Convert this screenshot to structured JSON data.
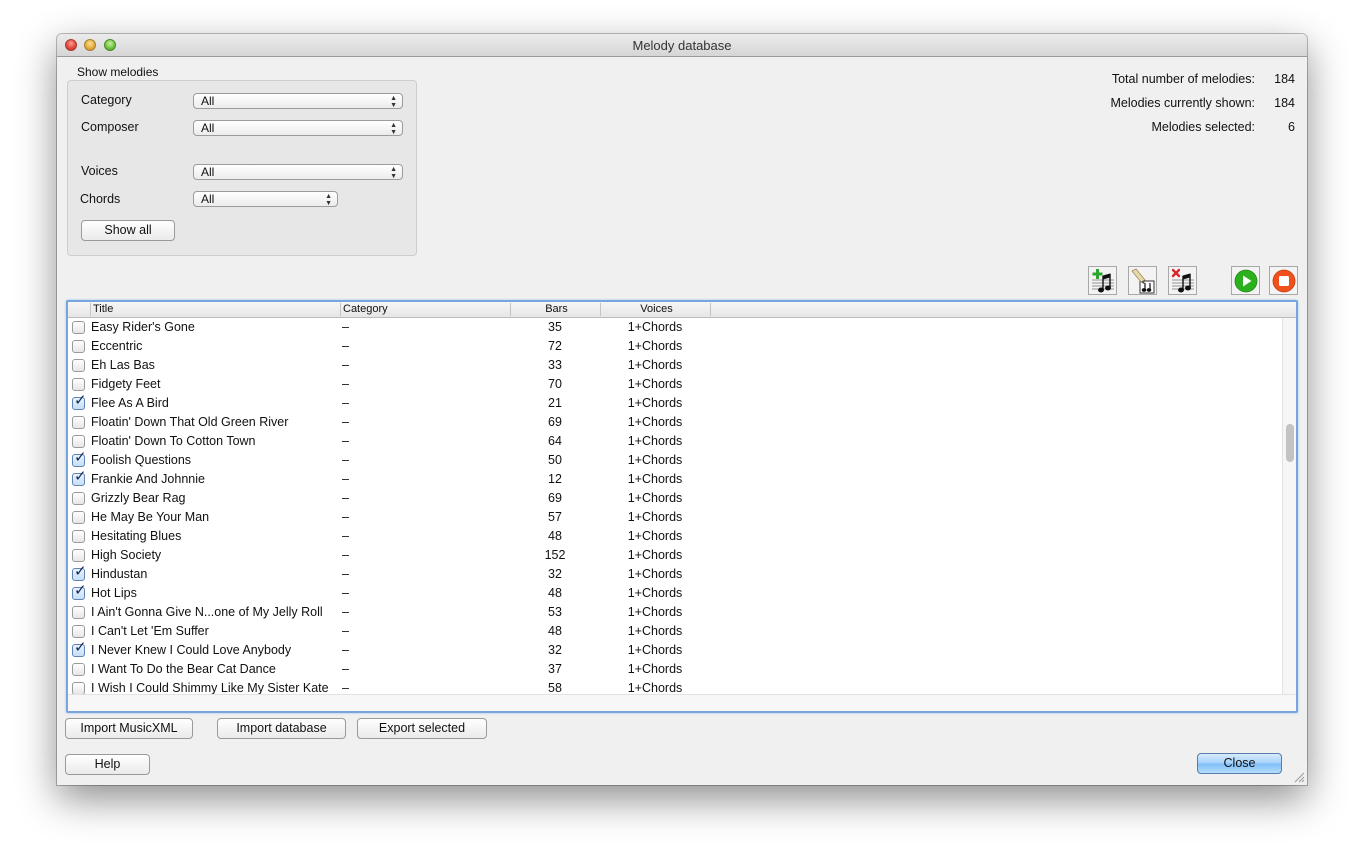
{
  "window": {
    "title": "Melody database"
  },
  "filters": {
    "group_label": "Show melodies",
    "category": {
      "label": "Category",
      "value": "All"
    },
    "composer": {
      "label": "Composer",
      "value": "All"
    },
    "voices": {
      "label": "Voices",
      "value": "All"
    },
    "chords": {
      "label": "Chords",
      "value": "All"
    },
    "show_all_label": "Show all"
  },
  "stats": {
    "total_label": "Total number of melodies:",
    "total_value": "184",
    "shown_label": "Melodies currently shown:",
    "shown_value": "184",
    "selected_label": "Melodies selected:",
    "selected_value": "6"
  },
  "toolbar": {
    "add_icon": "add-melody-icon",
    "edit_icon": "edit-melody-icon",
    "delete_icon": "delete-melody-icon",
    "play_icon": "play-icon",
    "stop_icon": "stop-icon",
    "play_color": "#2cb01e",
    "stop_color": "#f0501c"
  },
  "table": {
    "columns": [
      "Title",
      "Category",
      "Bars",
      "Voices"
    ],
    "rows": [
      {
        "checked": false,
        "title": "Easy Rider's Gone",
        "category": "–",
        "bars": "35",
        "voices": "1+Chords"
      },
      {
        "checked": false,
        "title": "Eccentric",
        "category": "–",
        "bars": "72",
        "voices": "1+Chords"
      },
      {
        "checked": false,
        "title": "Eh Las Bas",
        "category": "–",
        "bars": "33",
        "voices": "1+Chords"
      },
      {
        "checked": false,
        "title": "Fidgety Feet",
        "category": "–",
        "bars": "70",
        "voices": "1+Chords"
      },
      {
        "checked": true,
        "title": "Flee As A Bird",
        "category": "–",
        "bars": "21",
        "voices": "1+Chords"
      },
      {
        "checked": false,
        "title": "Floatin' Down That Old Green River",
        "category": "–",
        "bars": "69",
        "voices": "1+Chords"
      },
      {
        "checked": false,
        "title": "Floatin' Down To Cotton Town",
        "category": "–",
        "bars": "64",
        "voices": "1+Chords"
      },
      {
        "checked": true,
        "title": "Foolish Questions",
        "category": "–",
        "bars": "50",
        "voices": "1+Chords"
      },
      {
        "checked": true,
        "title": "Frankie And Johnnie",
        "category": "–",
        "bars": "12",
        "voices": "1+Chords"
      },
      {
        "checked": false,
        "title": "Grizzly Bear Rag",
        "category": "–",
        "bars": "69",
        "voices": "1+Chords"
      },
      {
        "checked": false,
        "title": "He May Be Your Man",
        "category": "–",
        "bars": "57",
        "voices": "1+Chords"
      },
      {
        "checked": false,
        "title": "Hesitating Blues",
        "category": "–",
        "bars": "48",
        "voices": "1+Chords"
      },
      {
        "checked": false,
        "title": "High Society",
        "category": "–",
        "bars": "152",
        "voices": "1+Chords"
      },
      {
        "checked": true,
        "title": "Hindustan",
        "category": "–",
        "bars": "32",
        "voices": "1+Chords"
      },
      {
        "checked": true,
        "title": "Hot Lips",
        "category": "–",
        "bars": "48",
        "voices": "1+Chords"
      },
      {
        "checked": false,
        "title": "I Ain't Gonna Give N...one of My Jelly Roll",
        "category": "–",
        "bars": "53",
        "voices": "1+Chords"
      },
      {
        "checked": false,
        "title": "I Can't Let 'Em Suffer",
        "category": "–",
        "bars": "48",
        "voices": "1+Chords"
      },
      {
        "checked": true,
        "title": "I Never Knew I Could Love Anybody",
        "category": "–",
        "bars": "32",
        "voices": "1+Chords"
      },
      {
        "checked": false,
        "title": "I Want To Do the Bear Cat Dance",
        "category": "–",
        "bars": "37",
        "voices": "1+Chords"
      },
      {
        "checked": false,
        "title": "I Wish I Could Shimmy Like My Sister Kate",
        "category": "–",
        "bars": "58",
        "voices": "1+Chords"
      }
    ]
  },
  "buttons": {
    "import_musicxml": "Import MusicXML",
    "import_database": "Import database",
    "export_selected": "Export selected",
    "help": "Help",
    "close": "Close"
  }
}
